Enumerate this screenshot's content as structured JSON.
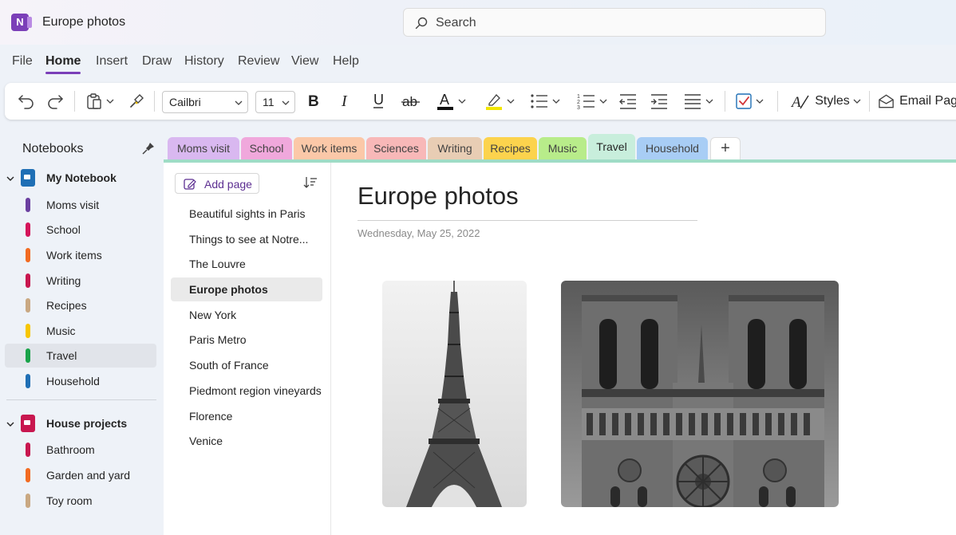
{
  "window": {
    "title": "Europe photos",
    "app_icon": "onenote-icon"
  },
  "search": {
    "placeholder": "Search"
  },
  "menu": [
    "File",
    "Home",
    "Insert",
    "Draw",
    "History",
    "Review",
    "View",
    "Help"
  ],
  "menu_active": "Home",
  "toolbar": {
    "font": "Cailbri",
    "size": "11",
    "styles_label": "Styles",
    "email_label": "Email Pag"
  },
  "sidebar": {
    "header": "Notebooks",
    "notebooks": [
      {
        "label": "My Notebook",
        "color": "#1f6fb5",
        "sections": [
          {
            "label": "Moms visit",
            "color": "#6b3fa0"
          },
          {
            "label": "School",
            "color": "#d4145a"
          },
          {
            "label": "Work items",
            "color": "#f26b21"
          },
          {
            "label": "Writing",
            "color": "#c8174f"
          },
          {
            "label": "Recipes",
            "color": "#c9a882"
          },
          {
            "label": "Music",
            "color": "#f7c600"
          },
          {
            "label": "Travel",
            "color": "#1aa34a"
          },
          {
            "label": "Household",
            "color": "#1f6fb5"
          }
        ]
      },
      {
        "label": "House projects",
        "color": "#c8174f",
        "sections": [
          {
            "label": "Bathroom",
            "color": "#c8174f"
          },
          {
            "label": "Garden and yard",
            "color": "#f26b21"
          },
          {
            "label": "Toy room",
            "color": "#c9a882"
          }
        ]
      }
    ],
    "selected_section": "Travel"
  },
  "tabs": [
    {
      "label": "Moms visit",
      "color": "#d9b8f0"
    },
    {
      "label": "School",
      "color": "#f0a8dc"
    },
    {
      "label": "Work items",
      "color": "#fbc8a8"
    },
    {
      "label": "Sciences",
      "color": "#f8b8b8"
    },
    {
      "label": "Writing",
      "color": "#e8cdb4"
    },
    {
      "label": "Recipes",
      "color": "#fcd34d"
    },
    {
      "label": "Music",
      "color": "#b8ec8a"
    },
    {
      "label": "Travel",
      "color": "#c8eedc"
    },
    {
      "label": "Household",
      "color": "#a8cdf5"
    }
  ],
  "active_tab": "Travel",
  "pagelist": {
    "add_page_label": "Add page",
    "pages": [
      "Beautiful sights in Paris",
      "Things to see at Notre...",
      "The Louvre",
      "Europe photos",
      "New York",
      "Paris Metro",
      "South of France",
      "Piedmont region vineyards",
      "Florence",
      "Venice"
    ],
    "selected": "Europe photos"
  },
  "page": {
    "title": "Europe photos",
    "date": "Wednesday, May 25, 2022"
  }
}
